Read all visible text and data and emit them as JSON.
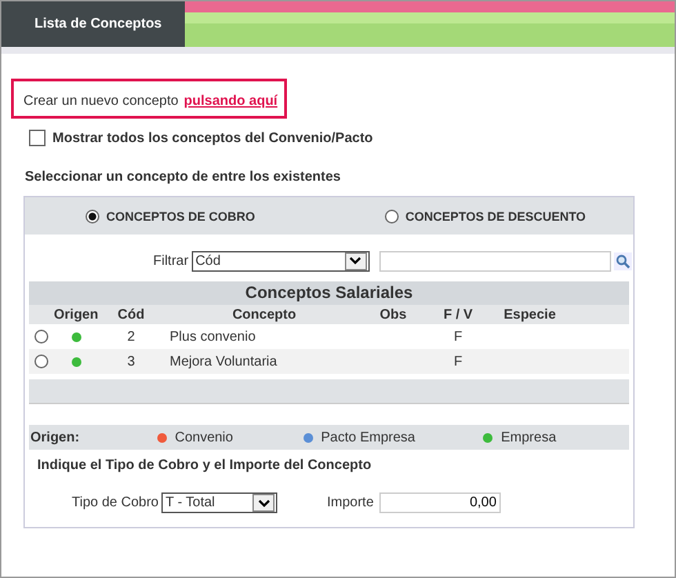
{
  "header": {
    "tab": "Lista de Conceptos"
  },
  "create": {
    "text": "Crear un nuevo concepto",
    "link": "pulsando aquí"
  },
  "show_all": {
    "label": "Mostrar todos los conceptos del Convenio/Pacto",
    "checked": false
  },
  "select_heading": "Seleccionar un concepto de entre los existentes",
  "concept_types": [
    {
      "label": "CONCEPTOS DE COBRO",
      "selected": true
    },
    {
      "label": "CONCEPTOS DE DESCUENTO",
      "selected": false
    }
  ],
  "filter": {
    "label": "Filtrar",
    "value": "Cód"
  },
  "table": {
    "title": "Conceptos Salariales",
    "columns": [
      "Origen",
      "Cód",
      "Concepto",
      "Obs",
      "F / V",
      "Especie"
    ],
    "rows": [
      {
        "selected": false,
        "color": "#3dbb3d",
        "cod": "2",
        "concepto": "Plus convenio",
        "fv": "F"
      },
      {
        "selected": false,
        "color": "#3dbb3d",
        "cod": "3",
        "concepto": "Mejora Voluntaria",
        "fv": "F"
      }
    ]
  },
  "legend": {
    "label": "Origen:",
    "items": [
      {
        "label": "Convenio",
        "color": "#f05a3c"
      },
      {
        "label": "Pacto Empresa",
        "color": "#5b8fd6"
      },
      {
        "label": "Empresa",
        "color": "#3dbb3d"
      }
    ]
  },
  "amount_heading": "Indique el Tipo de Cobro y el Importe del Concepto",
  "tipo_cobro": {
    "label": "Tipo de Cobro",
    "value": "T - Total"
  },
  "importe": {
    "label": "Importe",
    "value": "0,00"
  }
}
